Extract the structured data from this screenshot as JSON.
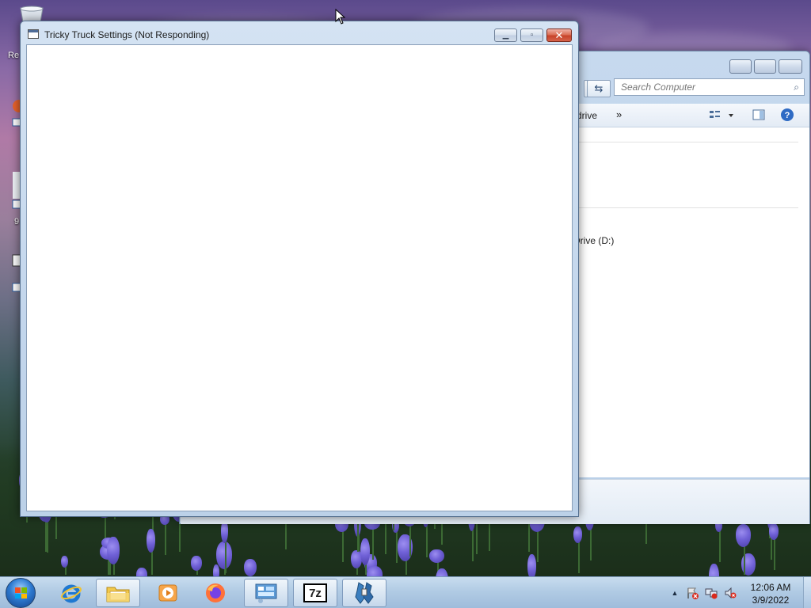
{
  "desktop": {
    "partial_labels": [
      "Re",
      "9"
    ]
  },
  "explorer": {
    "search_placeholder": "Search Computer",
    "toolbar_drive_text": "drive",
    "toolbar_more": "»",
    "drive_label": "Drive (D:)"
  },
  "dialog": {
    "title": "Tricky Truck Settings (Not Responding)",
    "minimize_glyph": "▁",
    "maximize_glyph": "▫",
    "close_glyph": "✕"
  },
  "taskbar": {
    "items": [
      {
        "name": "internet-explorer",
        "active": false
      },
      {
        "name": "windows-explorer",
        "active": true
      },
      {
        "name": "media-player",
        "active": false
      },
      {
        "name": "firefox",
        "active": false
      },
      {
        "name": "control-panel",
        "active": true
      },
      {
        "name": "7-zip",
        "active": true
      },
      {
        "name": "tricky-truck",
        "active": true
      }
    ],
    "sevenzip_text": "7z",
    "clock_time": "12:06 AM",
    "clock_date": "3/9/2022",
    "tray_expand": "▲"
  },
  "colors": {
    "close_red": "#c7432a",
    "taskbar_blue": "#b1cbe4",
    "wallpaper_purple": "#6f60d6"
  }
}
